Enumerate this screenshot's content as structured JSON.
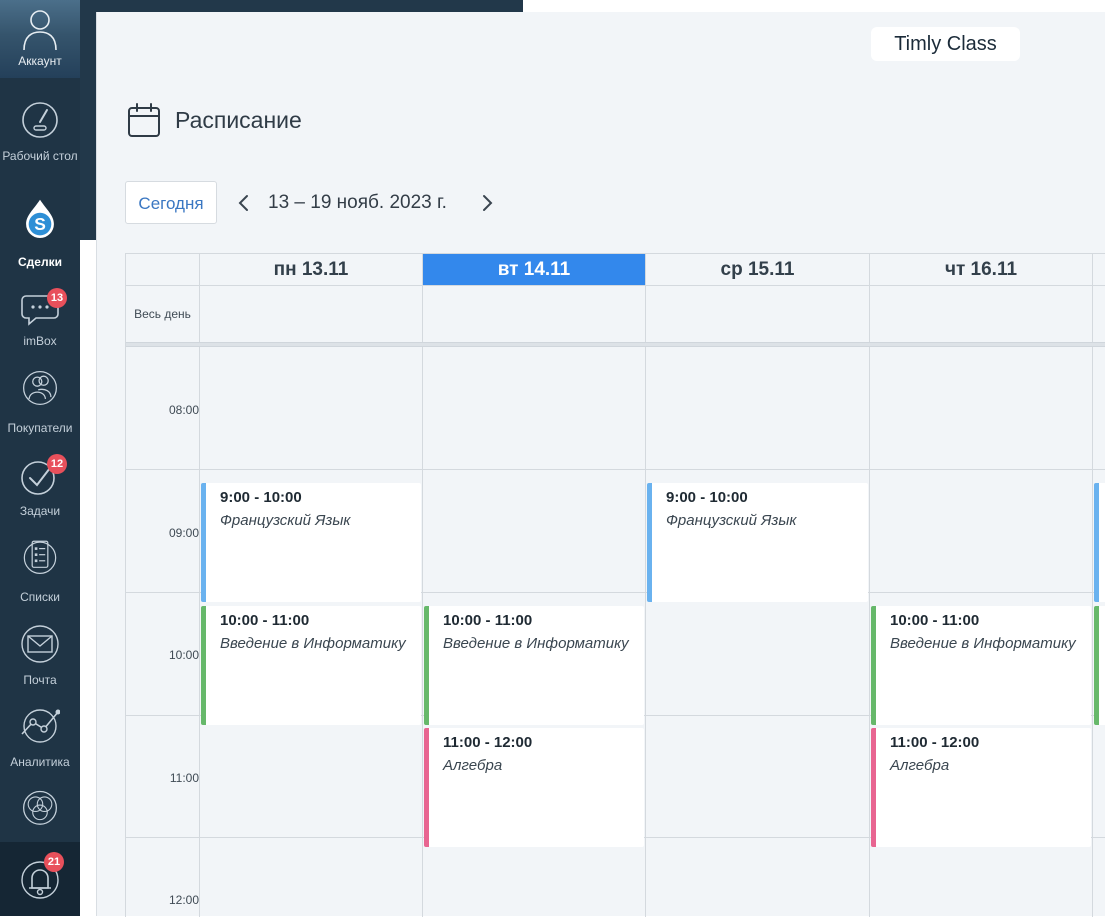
{
  "sidebar": {
    "account_label": "Аккаунт",
    "items": [
      {
        "label": "Рабочий стол",
        "icon": "gauge-icon"
      },
      {
        "label": "Сделки",
        "icon": "dollar-drop-icon",
        "active": true
      },
      {
        "label": "imBox",
        "icon": "chat-icon",
        "badge": "13"
      },
      {
        "label": "Покупатели",
        "icon": "customers-icon"
      },
      {
        "label": "Задачи",
        "icon": "check-circle-icon",
        "badge": "12"
      },
      {
        "label": "Списки",
        "icon": "list-icon"
      },
      {
        "label": "Почта",
        "icon": "mail-icon"
      },
      {
        "label": "Аналитика",
        "icon": "analytics-icon"
      },
      {
        "label": "",
        "icon": "integrations-icon"
      }
    ],
    "notifications_badge": "21"
  },
  "header": {
    "brand": "Timly Class",
    "title": "Расписание"
  },
  "toolbar": {
    "today_label": "Сегодня",
    "range": "13 – 19 нояб. 2023 г."
  },
  "calendar": {
    "allday_label": "Весь день",
    "days": [
      {
        "label": "пн 13.11"
      },
      {
        "label": "вт 14.11",
        "today": true
      },
      {
        "label": "ср 15.11"
      },
      {
        "label": "чт 16.11"
      }
    ],
    "hours": [
      "08:00",
      "09:00",
      "10:00",
      "11:00",
      "12:00"
    ],
    "events": [
      {
        "day": 0,
        "time": "9:00 - 10:00",
        "name": "Французский Язык",
        "color": "#6ab2ef"
      },
      {
        "day": 2,
        "time": "9:00 - 10:00",
        "name": "Французский Язык",
        "color": "#6ab2ef"
      },
      {
        "day": 0,
        "time": "10:00 - 11:00",
        "name": "Введение в Информатику",
        "color": "#66b86a"
      },
      {
        "day": 1,
        "time": "10:00 - 11:00",
        "name": "Введение в Информатику",
        "color": "#66b86a"
      },
      {
        "day": 3,
        "time": "10:00 - 11:00",
        "name": "Введение в Информатику",
        "color": "#66b86a"
      },
      {
        "day": 1,
        "time": "11:00 - 12:00",
        "name": "Алгебра",
        "color": "#e86591"
      },
      {
        "day": 3,
        "time": "11:00 - 12:00",
        "name": "Алгебра",
        "color": "#e86591"
      }
    ]
  },
  "colors": {
    "accent": "#3388ec",
    "sidebar_bg": "#1f3445",
    "badge": "#e8505b"
  }
}
